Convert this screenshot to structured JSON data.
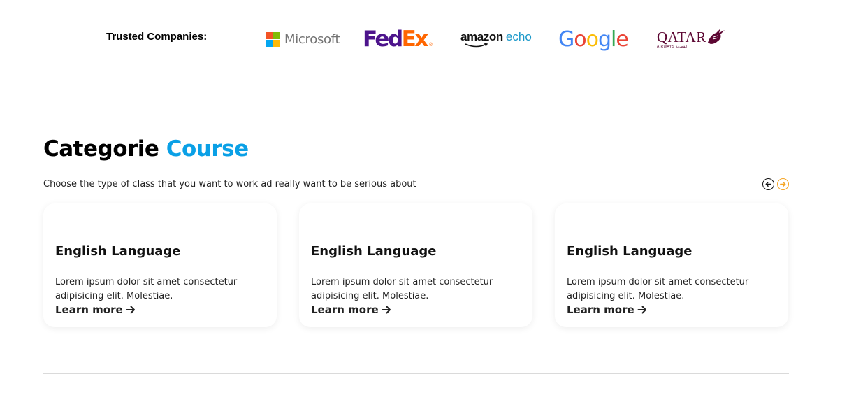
{
  "trusted": {
    "label": "Trusted Companies:",
    "logos": {
      "microsoft": "Microsoft",
      "fedex_fed": "Fed",
      "fedex_ex": "Ex",
      "amazon": "amazon",
      "echo": "echo",
      "google": [
        "G",
        "o",
        "o",
        "g",
        "l",
        "e"
      ],
      "qatar": "QATAR",
      "qatar_sub": "AIRWAYS القطرية"
    }
  },
  "section": {
    "title_main": "Categorie",
    "title_accent": "Course",
    "subtitle": "Choose the type of class that you want to work ad really want to be serious about"
  },
  "cards": [
    {
      "title": "English Language",
      "description": "Lorem ipsum dolor sit amet consectetur adipisicing elit. Molestiae.",
      "link": "Learn more"
    },
    {
      "title": "English Language",
      "description": "Lorem ipsum dolor sit amet consectetur adipisicing elit. Molestiae.",
      "link": "Learn more"
    },
    {
      "title": "English Language",
      "description": "Lorem ipsum dolor sit amet consectetur adipisicing elit. Molestiae.",
      "link": "Learn more"
    }
  ],
  "icons": {
    "prev": "arrow-left-circle-icon",
    "next": "arrow-right-circle-icon",
    "link": "arrow-right-icon"
  },
  "colors": {
    "accent": "#0aa0e6",
    "next_arrow": "#f5a524",
    "fedex_purple": "#4d148c",
    "fedex_orange": "#ff6600",
    "qatar": "#5c0632"
  }
}
